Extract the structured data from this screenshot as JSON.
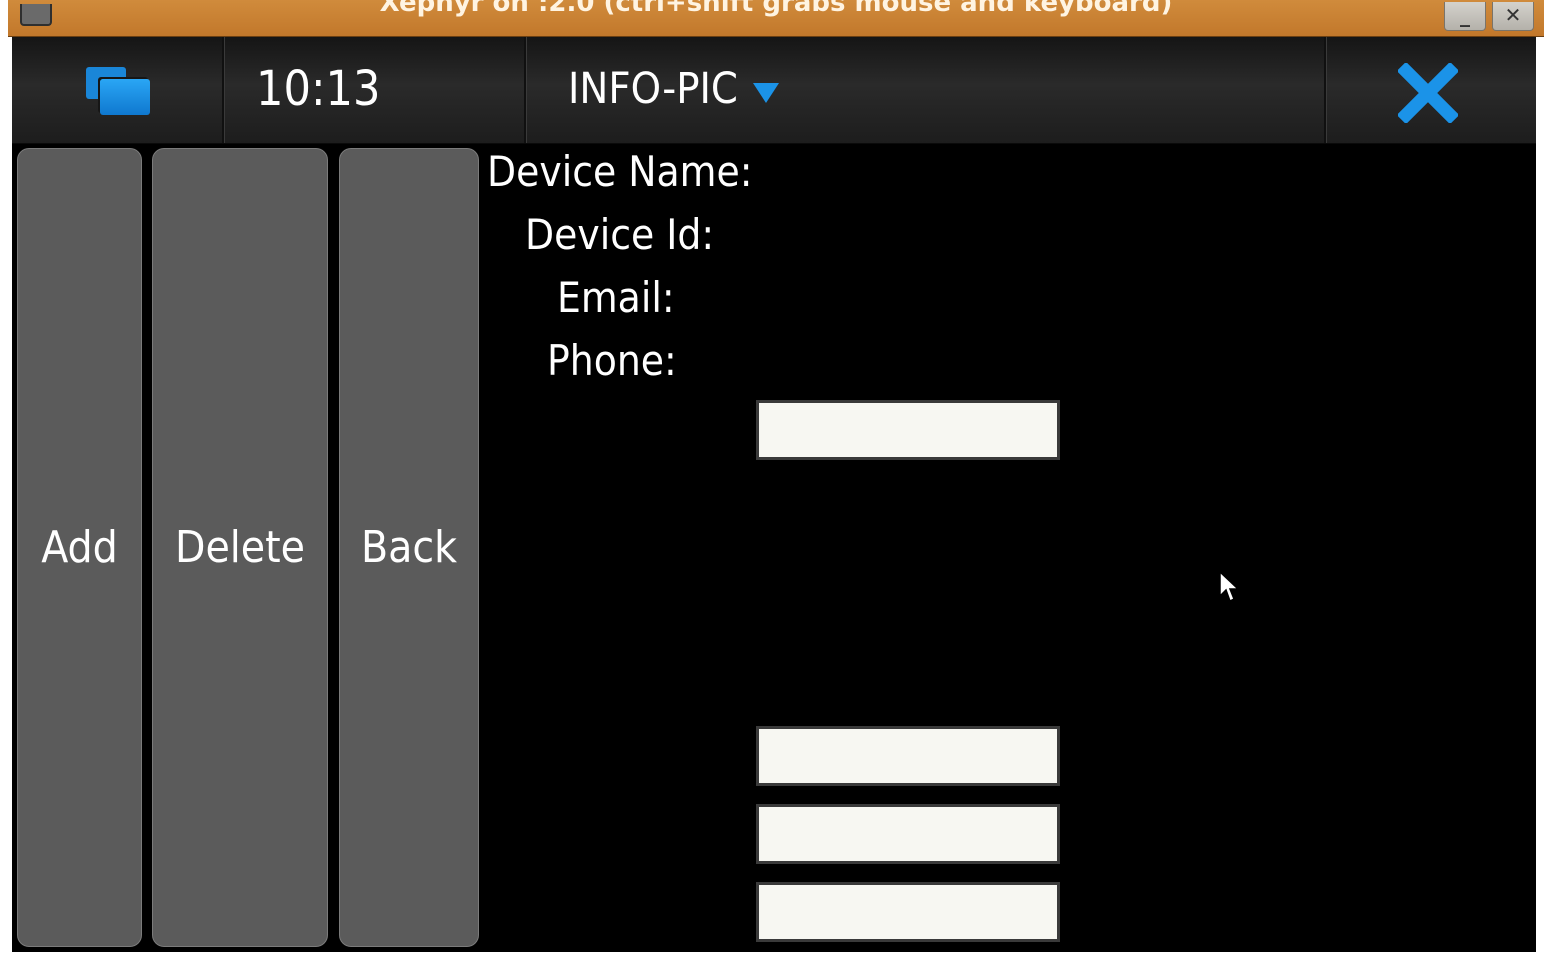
{
  "host_window": {
    "title": "Xephyr on :2.0 (ctrl+shift grabs mouse and keyboard)",
    "minimize_label": "_",
    "close_label": "✕"
  },
  "statusbar": {
    "task_switcher_icon": "task-switcher-icon",
    "clock": "10:13",
    "app_title": "INFO-PIC",
    "menu_icon": "chevron-down-icon",
    "close_icon": "close-icon",
    "accent_color": "#1b93e8"
  },
  "buttons": {
    "add": "Add",
    "delete": "Delete",
    "back": "Back"
  },
  "form": {
    "device_name_label": "Device Name:",
    "device_id_label": "Device Id:",
    "email_label": "Email:",
    "phone_label": "Phone:",
    "fields": [
      "",
      "",
      "",
      ""
    ]
  }
}
